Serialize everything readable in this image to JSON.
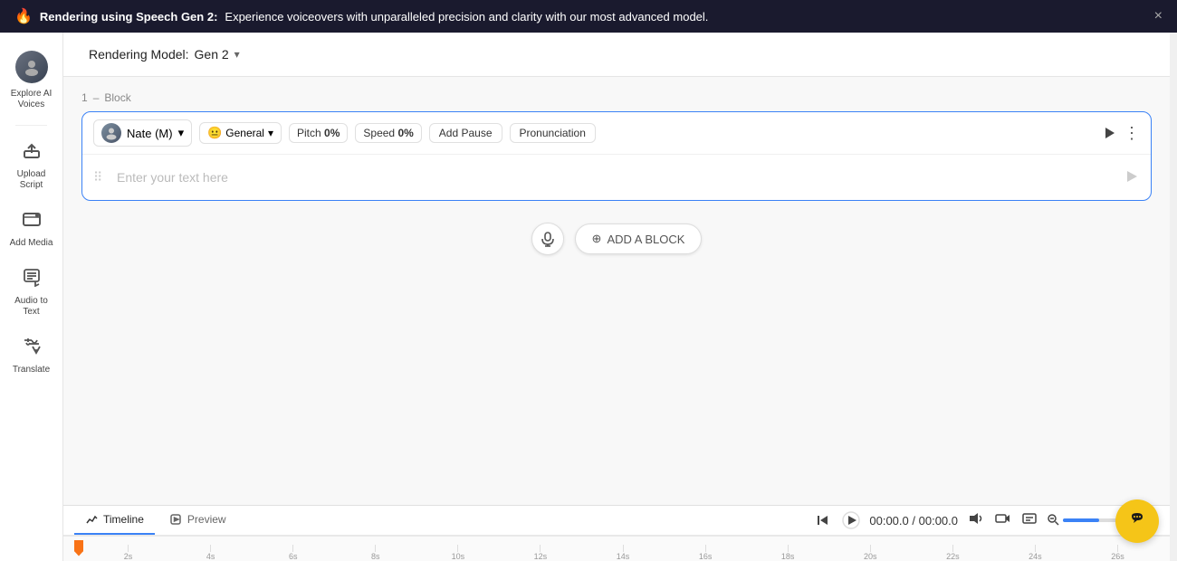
{
  "banner": {
    "fire_icon": "🔥",
    "text_bold": "Rendering using Speech Gen 2:",
    "text_normal": "Experience voiceovers with unparalleled precision and clarity with our most advanced model.",
    "close_label": "×"
  },
  "sidebar": {
    "items": [
      {
        "id": "explore-ai",
        "icon": "👤",
        "label": "Explore AI Voices",
        "type": "avatar"
      },
      {
        "id": "upload-script",
        "icon": "⬆",
        "label": "Upload Script"
      },
      {
        "id": "add-media",
        "icon": "🎬",
        "label": "Add Media"
      },
      {
        "id": "audio-to-text",
        "icon": "📊",
        "label": "Audio to Text"
      },
      {
        "id": "translate",
        "icon": "🌐",
        "label": "Translate"
      }
    ]
  },
  "header": {
    "label": "Rendering Model:",
    "model": "Gen 2",
    "chevron": "▾"
  },
  "block": {
    "number": "1",
    "separator": "–",
    "type_label": "Block",
    "voice_name": "Nate (M)",
    "voice_chevron": "▾",
    "style_emoji": "😐",
    "style_label": "General",
    "style_chevron": "▾",
    "pitch_label": "Pitch",
    "pitch_value": "0%",
    "speed_label": "Speed",
    "speed_value": "0%",
    "add_pause_label": "Add Pause",
    "pronunciation_label": "Pronunciation",
    "text_placeholder": "Enter your text here",
    "play_icon": "▶",
    "more_icon": "⋮"
  },
  "add_block": {
    "mic_icon": "🎤",
    "plus_icon": "⊕",
    "label": "ADD A BLOCK"
  },
  "timeline": {
    "tab_timeline_icon": "△",
    "tab_timeline_label": "Timeline",
    "tab_preview_icon": "▷",
    "tab_preview_label": "Preview",
    "skip_back_icon": "⏮",
    "play_icon": "▶",
    "time_current": "00:00.0",
    "time_total": "00:00.0",
    "time_separator": "/",
    "volume_icon": "🔊",
    "camera_icon": "🎬",
    "caption_icon": "⊞",
    "zoom_in_icon": "🔍",
    "zoom_out_icon": "🔍",
    "ticks": [
      "2s",
      "4s",
      "6s",
      "8s",
      "10s",
      "12s",
      "14s",
      "16s",
      "18s",
      "20s",
      "22s",
      "24s",
      "26s"
    ]
  },
  "chat": {
    "icon": "💬"
  }
}
